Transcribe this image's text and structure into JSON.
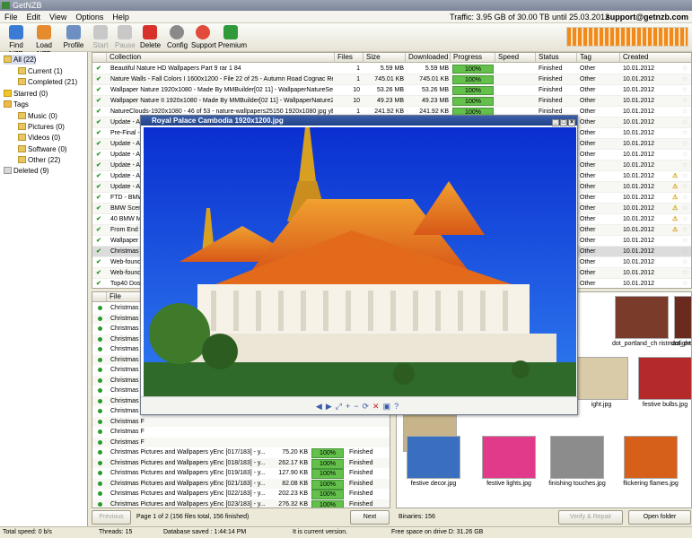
{
  "window_title": "GetNZB",
  "menu": [
    "File",
    "Edit",
    "View",
    "Options",
    "Help"
  ],
  "traffic": "Traffic: 3.95 GB of 30.00 TB until 25.03.2012",
  "support_email": "support@getnzb.com",
  "toolbar": [
    {
      "label": "Find NZB",
      "icon": "find-nzb-icon",
      "enabled": true
    },
    {
      "label": "Load NZB",
      "icon": "load-nzb-icon",
      "enabled": true
    },
    {
      "label": "Profile",
      "icon": "profile-icon",
      "enabled": true
    },
    {
      "label": "Start",
      "icon": "start-icon",
      "enabled": false
    },
    {
      "label": "Pause",
      "icon": "pause-icon",
      "enabled": false
    },
    {
      "label": "Delete",
      "icon": "delete-icon",
      "enabled": true
    },
    {
      "label": "Config",
      "icon": "gear-icon",
      "enabled": true
    },
    {
      "label": "Support",
      "icon": "lifebuoy-icon",
      "enabled": true
    },
    {
      "label": "Premium",
      "icon": "premium-icon",
      "enabled": true
    }
  ],
  "sidebar": [
    {
      "label": "All (22)",
      "selected": true
    },
    {
      "label": "Current (1)"
    },
    {
      "label": "Completed (21)"
    },
    {
      "label": "Starred (0)"
    },
    {
      "label": "Tags"
    },
    {
      "label": "Music (0)"
    },
    {
      "label": "Pictures (0)"
    },
    {
      "label": "Videos (0)"
    },
    {
      "label": "Software (0)"
    },
    {
      "label": "Other (22)"
    },
    {
      "label": "Deleted (9)"
    }
  ],
  "collections_headers": [
    "Collection",
    "Files",
    "Size",
    "Downloaded",
    "Progress",
    "Speed",
    "Status",
    "Tag",
    "Created"
  ],
  "collections": [
    {
      "name": "Beautiful Nature HD Wallpapers Part 9 rar 1 84",
      "files": "1",
      "size": "5.59 MB",
      "downloaded": "5.59 MB",
      "progress": "100%",
      "status": "Finished",
      "tag": "Other",
      "created": "10.01.2012",
      "warn": false
    },
    {
      "name": "Nature Walls - Fall Colors I 1600x1200 - File 22 of 25 - Autumn Road Cognac Regio...",
      "files": "1",
      "size": "745.01 KB",
      "downloaded": "745.01 KB",
      "progress": "100%",
      "status": "Finished",
      "tag": "Other",
      "created": "10.01.2012",
      "warn": false
    },
    {
      "name": "Wallpaper Nature 1920x1080 - Made By MMBuilder[02 11] - WallpaperNatureSetup...",
      "files": "10",
      "size": "53.26 MB",
      "downloaded": "53.26 MB",
      "progress": "100%",
      "status": "Finished",
      "tag": "Other",
      "created": "10.01.2012",
      "warn": false
    },
    {
      "name": "Wallpaper Nature II 1920x1080 - Made By MMBuilder[02 11] - WallpaperNature2Se...",
      "files": "10",
      "size": "49.23 MB",
      "downloaded": "49.23 MB",
      "progress": "100%",
      "status": "Finished",
      "tag": "Other",
      "created": "10.01.2012",
      "warn": false
    },
    {
      "name": "NatureClouds-1920x1080 - 46 of 53 - nature-wallpapers25150 1920x1080 jpg yEnc...",
      "files": "1",
      "size": "241.92 KB",
      "downloaded": "241.92 KB",
      "progress": "100%",
      "status": "Finished",
      "tag": "Other",
      "created": "10.01.2012",
      "warn": false
    },
    {
      "name": "Update - A",
      "status": "Finished",
      "tag": "Other",
      "created": "10.01.2012",
      "warn": false
    },
    {
      "name": "Pre-Final -",
      "status": "Finished",
      "tag": "Other",
      "created": "10.01.2012",
      "warn": false
    },
    {
      "name": "Update - A",
      "status": "Finished",
      "tag": "Other",
      "created": "10.01.2012",
      "warn": false
    },
    {
      "name": "Update - A",
      "status": "Finished",
      "tag": "Other",
      "created": "10.01.2012",
      "warn": false
    },
    {
      "name": "Update - A",
      "status": "Finished",
      "tag": "Other",
      "created": "10.01.2012",
      "warn": false
    },
    {
      "name": "Update - A",
      "status": "Finished",
      "tag": "Other",
      "created": "10.01.2012",
      "warn": true
    },
    {
      "name": "Update - A",
      "status": "Finished",
      "tag": "Other",
      "created": "10.01.2012",
      "warn": true
    },
    {
      "name": "FTD - BMW",
      "status": "Finished",
      "tag": "Other",
      "created": "10.01.2012",
      "warn": true
    },
    {
      "name": "BMW Scene",
      "status": "Finished",
      "tag": "Other",
      "created": "10.01.2012",
      "warn": true
    },
    {
      "name": "40 BMW Mo",
      "status": "Finished",
      "tag": "Other",
      "created": "10.01.2012",
      "warn": true
    },
    {
      "name": "From End to",
      "status": "Finished",
      "tag": "Other",
      "created": "10.01.2012",
      "warn": true
    },
    {
      "name": "Wallpaper p",
      "status": "Finished",
      "tag": "Other",
      "created": "10.01.2012",
      "warn": false
    },
    {
      "name": "Christmas P",
      "status": "Finished",
      "tag": "Other",
      "created": "10.01.2012",
      "warn": false,
      "selected": true
    },
    {
      "name": "Web-found",
      "status": "Finished",
      "tag": "Other",
      "created": "10.01.2012",
      "warn": false
    },
    {
      "name": "Web-found",
      "status": "Finished",
      "tag": "Other",
      "created": "10.01.2012",
      "warn": false
    },
    {
      "name": "Top40 Doss",
      "status": "Finished",
      "tag": "Other",
      "created": "10.01.2012",
      "warn": false
    }
  ],
  "files_header": "File",
  "files": [
    {
      "name": "Christmas F"
    },
    {
      "name": "Christmas F"
    },
    {
      "name": "Christmas F"
    },
    {
      "name": "Christmas F"
    },
    {
      "name": "Christmas F"
    },
    {
      "name": "Christmas F"
    },
    {
      "name": "Christmas F"
    },
    {
      "name": "Christmas F"
    },
    {
      "name": "Christmas F"
    },
    {
      "name": "Christmas F"
    },
    {
      "name": "Christmas F"
    },
    {
      "name": "Christmas F"
    },
    {
      "name": "Christmas F"
    },
    {
      "name": "Christmas F"
    },
    {
      "name": "Christmas Pictures and Wallpapers yEnc [017/183] - y...",
      "size": "75.20 KB",
      "progress": "100%",
      "status": "Finished"
    },
    {
      "name": "Christmas Pictures and Wallpapers yEnc [018/183] - y...",
      "size": "262.17 KB",
      "progress": "100%",
      "status": "Finished"
    },
    {
      "name": "Christmas Pictures and Wallpapers yEnc [019/183] - y...",
      "size": "127.90 KB",
      "progress": "100%",
      "status": "Finished"
    },
    {
      "name": "Christmas Pictures and Wallpapers yEnc [021/183] - y...",
      "size": "82.08 KB",
      "progress": "100%",
      "status": "Finished"
    },
    {
      "name": "Christmas Pictures and Wallpapers yEnc [022/183] - y...",
      "size": "202.23 KB",
      "progress": "100%",
      "status": "Finished"
    },
    {
      "name": "Christmas Pictures and Wallpapers yEnc [023/183] - y...",
      "size": "276.32 KB",
      "progress": "100%",
      "status": "Finished"
    },
    {
      "name": "Christmas Pictures and Wallpapers yEnc [025/183] - y...",
      "size": "74.91 KB",
      "progress": "100%",
      "status": "Finished"
    },
    {
      "name": "Christmas Pictures and Wallpapers yEnc [026/183] - y...",
      "size": "510.12 KB",
      "progress": "100%",
      "status": "Finished"
    },
    {
      "name": "Christmas Pictures and Wallpapers yEnc [028/183] - y...",
      "size": "95.25 KB",
      "progress": "100%",
      "status": "Finished"
    }
  ],
  "thumbnails": [
    {
      "caption": "dot_portland_ch ristmaslights(7).jpg",
      "color": "#7a3b2a"
    },
    {
      "caption": "dot_oregonportland_ch ristmaslights(9).jpg",
      "color": "#6b2a1e"
    },
    {
      "caption": "ight.jpg",
      "color": "#d9cba8"
    },
    {
      "caption": "festive bulbs.jpg",
      "color": "#b42a2a"
    },
    {
      "caption": "christmas.jpg",
      "color": "#c8b48a"
    },
    {
      "caption": "festive decor.jpg",
      "color": "#3a6fbf"
    },
    {
      "caption": "festive lights.jpg",
      "color": "#e23a8a"
    },
    {
      "caption": "finishing touches.jpg",
      "color": "#8c8c8c"
    },
    {
      "caption": "flickering flames.jpg",
      "color": "#d6601a"
    }
  ],
  "viewer_title": "Royal Palace Cambodia 1920x1200.jpg",
  "pager": {
    "previous": "Previous",
    "info": "Page 1 of 2 (156 files total, 156 finished)",
    "next": "Next",
    "binaries": "Binaries: 156",
    "verify": "Verify & Repair",
    "open_folder": "Open folder"
  },
  "status": {
    "speed": "Total speed: 0 b/s",
    "threads": "Threads: 15",
    "saved": "Database saved : 1:44:14 PM",
    "version": "It is current version.",
    "space": "Free space on drive D: 31.26 GB"
  },
  "colors": {
    "accent": "#20428a",
    "progress": "#63c04b",
    "quota": "#f08a1c"
  }
}
